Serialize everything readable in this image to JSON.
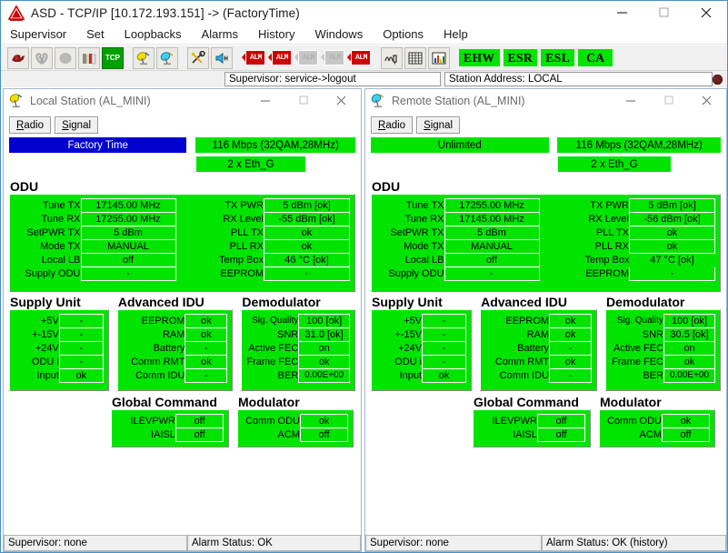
{
  "window": {
    "title": "ASD - TCP/IP [10.172.193.151] -> (FactoryTime)",
    "app_icon": "warning-triangle-icon",
    "minimize": "minimize-icon",
    "maximize": "maximize-icon",
    "close": "close-icon"
  },
  "menubar": {
    "items": [
      "Supervisor",
      "Set",
      "Loopbacks",
      "Alarms",
      "History",
      "Windows",
      "Options",
      "Help"
    ]
  },
  "toolbar": {
    "icons": [
      {
        "name": "bird-icon",
        "glyph": "◆"
      },
      {
        "name": "broken-heart-icon",
        "glyph": "♥"
      },
      {
        "name": "gray-circle-icon",
        "glyph": "●"
      },
      {
        "name": "books-icon",
        "glyph": "▤"
      },
      {
        "name": "tcp-icon",
        "glyph": "TCP"
      },
      {
        "name": "local-station-icon",
        "glyph": "◢"
      },
      {
        "name": "remote-station-icon",
        "glyph": "◣"
      },
      {
        "name": "tools-icon",
        "glyph": "⚒"
      },
      {
        "name": "speaker-icon",
        "glyph": "◀"
      },
      {
        "name": "performance-icon",
        "glyph": "⌇"
      },
      {
        "name": "grid-icon",
        "glyph": "▦"
      },
      {
        "name": "chart-icon",
        "glyph": "▥"
      }
    ],
    "flags": [
      {
        "name": "flag-alarm-1",
        "label": "ALM",
        "color": "#cc0000",
        "active": true
      },
      {
        "name": "flag-alarm-2",
        "label": "ALM",
        "color": "#cc0000",
        "active": true
      },
      {
        "name": "flag-alarm-3",
        "label": "ALM",
        "color": "#bdbdbd",
        "active": false
      },
      {
        "name": "flag-alarm-4",
        "label": "ALM",
        "color": "#bdbdbd",
        "active": false
      },
      {
        "name": "flag-alarm-5",
        "label": "ALM",
        "color": "#cc0000",
        "active": true
      }
    ],
    "status_badges": [
      {
        "name": "badge-ehw",
        "label": "EHW",
        "color": "#00e400"
      },
      {
        "name": "badge-esr",
        "label": "ESR",
        "color": "#00e400"
      },
      {
        "name": "badge-esl",
        "label": "ESL",
        "color": "#00e400"
      },
      {
        "name": "badge-ca",
        "label": "CA",
        "color": "#00e400"
      }
    ]
  },
  "infostrip": {
    "supervisor": "Supervisor: service->logout",
    "station_address": "Station Address: LOCAL",
    "led": "connection-led"
  },
  "stations": [
    {
      "id": "local",
      "title": "Local Station (AL_MINI)",
      "icon": "satellite-dish-icon",
      "tabs": [
        {
          "label": "Radio",
          "accel": "R",
          "selected": true
        },
        {
          "label": "Signal",
          "accel": "S",
          "selected": false
        }
      ],
      "top_bars": {
        "mode": {
          "text": "Factory Time",
          "color": "#0000d0"
        },
        "capacity": {
          "text": "116 Mbps (32QAM,28MHz)",
          "color": "#00e400"
        },
        "interface": {
          "text": "2 x Eth_G",
          "color": "#00e400"
        }
      },
      "odu": {
        "title": "ODU",
        "left": [
          {
            "k": "Tune TX",
            "v": "17145.00 MHz"
          },
          {
            "k": "Tune RX",
            "v": "17255.00 MHz"
          },
          {
            "k": "SetPWR TX",
            "v": "5 dBm"
          },
          {
            "k": "Mode TX",
            "v": "MANUAL"
          },
          {
            "k": "Local LB",
            "v": "off"
          },
          {
            "k": "Supply ODU",
            "v": "-"
          }
        ],
        "right": [
          {
            "k": "TX PWR",
            "v": "5 dBm [ok]"
          },
          {
            "k": "RX Level",
            "v": "-55 dBm [ok]"
          },
          {
            "k": "PLL TX",
            "v": "ok"
          },
          {
            "k": "PLL RX",
            "v": "ok"
          },
          {
            "k": "Temp Box",
            "v": "46 °C [ok]"
          },
          {
            "k": "EEPROM",
            "v": "-"
          }
        ]
      },
      "supply_unit": {
        "title": "Supply Unit",
        "rows": [
          {
            "k": "+5V",
            "v": "-"
          },
          {
            "k": "+-15V",
            "v": "-"
          },
          {
            "k": "+24V",
            "v": "-"
          },
          {
            "k": "ODU  i",
            "v": "-"
          },
          {
            "k": "Input",
            "v": "ok"
          }
        ]
      },
      "advanced_idu": {
        "title": "Advanced IDU",
        "rows": [
          {
            "k": "EEPROM",
            "v": "ok"
          },
          {
            "k": "RAM",
            "v": "ok"
          },
          {
            "k": "Battery",
            "v": "-"
          },
          {
            "k": "Comm RMT",
            "v": "ok"
          },
          {
            "k": "Comm IDU",
            "v": "-"
          }
        ]
      },
      "demodulator": {
        "title": "Demodulator",
        "rows": [
          {
            "k": "Sig. Quality",
            "v": "100 [ok]"
          },
          {
            "k": "SNR",
            "v": "31.0 [ok]"
          },
          {
            "k": "Active FEC",
            "v": "on"
          },
          {
            "k": "Frame FEC",
            "v": "ok"
          },
          {
            "k": "BER",
            "v": "0.00E+00"
          }
        ]
      },
      "global_command": {
        "title": "Global Command",
        "rows": [
          {
            "k": "ILEVPWR",
            "v": "off"
          },
          {
            "k": "IAISL",
            "v": "off"
          }
        ]
      },
      "modulator": {
        "title": "Modulator",
        "rows": [
          {
            "k": "Comm ODU",
            "v": "ok"
          },
          {
            "k": "ACM",
            "v": "off"
          }
        ]
      },
      "status": {
        "supervisor": "Supervisor: none",
        "alarm": "Alarm Status: OK"
      }
    },
    {
      "id": "remote",
      "title": "Remote Station (AL_MINI)",
      "icon": "satellite-dish-icon",
      "tabs": [
        {
          "label": "Radio",
          "accel": "R",
          "selected": true
        },
        {
          "label": "Signal",
          "accel": "S",
          "selected": false
        }
      ],
      "top_bars": {
        "mode": {
          "text": "Unlimited",
          "color": "#00e400"
        },
        "capacity": {
          "text": "116 Mbps (32QAM,28MHz)",
          "color": "#00e400"
        },
        "interface": {
          "text": "2 x Eth_G",
          "color": "#00e400"
        }
      },
      "odu": {
        "title": "ODU",
        "left": [
          {
            "k": "Tune TX",
            "v": "17255.00 MHz"
          },
          {
            "k": "Tune RX",
            "v": "17145.00 MHz"
          },
          {
            "k": "SetPWR TX",
            "v": "5 dBm"
          },
          {
            "k": "Mode TX",
            "v": "MANUAL"
          },
          {
            "k": "Local LB",
            "v": "off"
          },
          {
            "k": "Supply ODU",
            "v": "-"
          }
        ],
        "right": [
          {
            "k": "TX PWR",
            "v": "5 dBm [ok]"
          },
          {
            "k": "RX Level",
            "v": "-56 dBm [ok]"
          },
          {
            "k": "PLL TX",
            "v": "ok"
          },
          {
            "k": "PLL RX",
            "v": "ok"
          },
          {
            "k": "Temp Box",
            "v": "47 °C [ok]"
          },
          {
            "k": "EEPROM",
            "v": "-"
          }
        ]
      },
      "supply_unit": {
        "title": "Supply Unit",
        "rows": [
          {
            "k": "+5V",
            "v": "-"
          },
          {
            "k": "+-15V",
            "v": "-"
          },
          {
            "k": "+24V",
            "v": "-"
          },
          {
            "k": "ODU  i",
            "v": "-"
          },
          {
            "k": "Input",
            "v": "ok"
          }
        ]
      },
      "advanced_idu": {
        "title": "Advanced IDU",
        "rows": [
          {
            "k": "EEPROM",
            "v": "ok"
          },
          {
            "k": "RAM",
            "v": "ok"
          },
          {
            "k": "Battery",
            "v": "-"
          },
          {
            "k": "Comm RMT",
            "v": "ok"
          },
          {
            "k": "Comm IDU",
            "v": "-"
          }
        ]
      },
      "demodulator": {
        "title": "Demodulator",
        "rows": [
          {
            "k": "Sig. Quality",
            "v": "100 [ok]"
          },
          {
            "k": "SNR",
            "v": "30.5 [ok]"
          },
          {
            "k": "Active FEC",
            "v": "on"
          },
          {
            "k": "Frame FEC",
            "v": "ok"
          },
          {
            "k": "BER",
            "v": "0.00E+00"
          }
        ]
      },
      "global_command": {
        "title": "Global Command",
        "rows": [
          {
            "k": "ILEVPWR",
            "v": "off"
          },
          {
            "k": "IAISL",
            "v": "off"
          }
        ]
      },
      "modulator": {
        "title": "Modulator",
        "rows": [
          {
            "k": "Comm ODU",
            "v": "ok"
          },
          {
            "k": "ACM",
            "v": "off"
          }
        ]
      },
      "status": {
        "supervisor": "Supervisor: none",
        "alarm": "Alarm Status: OK (history)"
      }
    }
  ]
}
